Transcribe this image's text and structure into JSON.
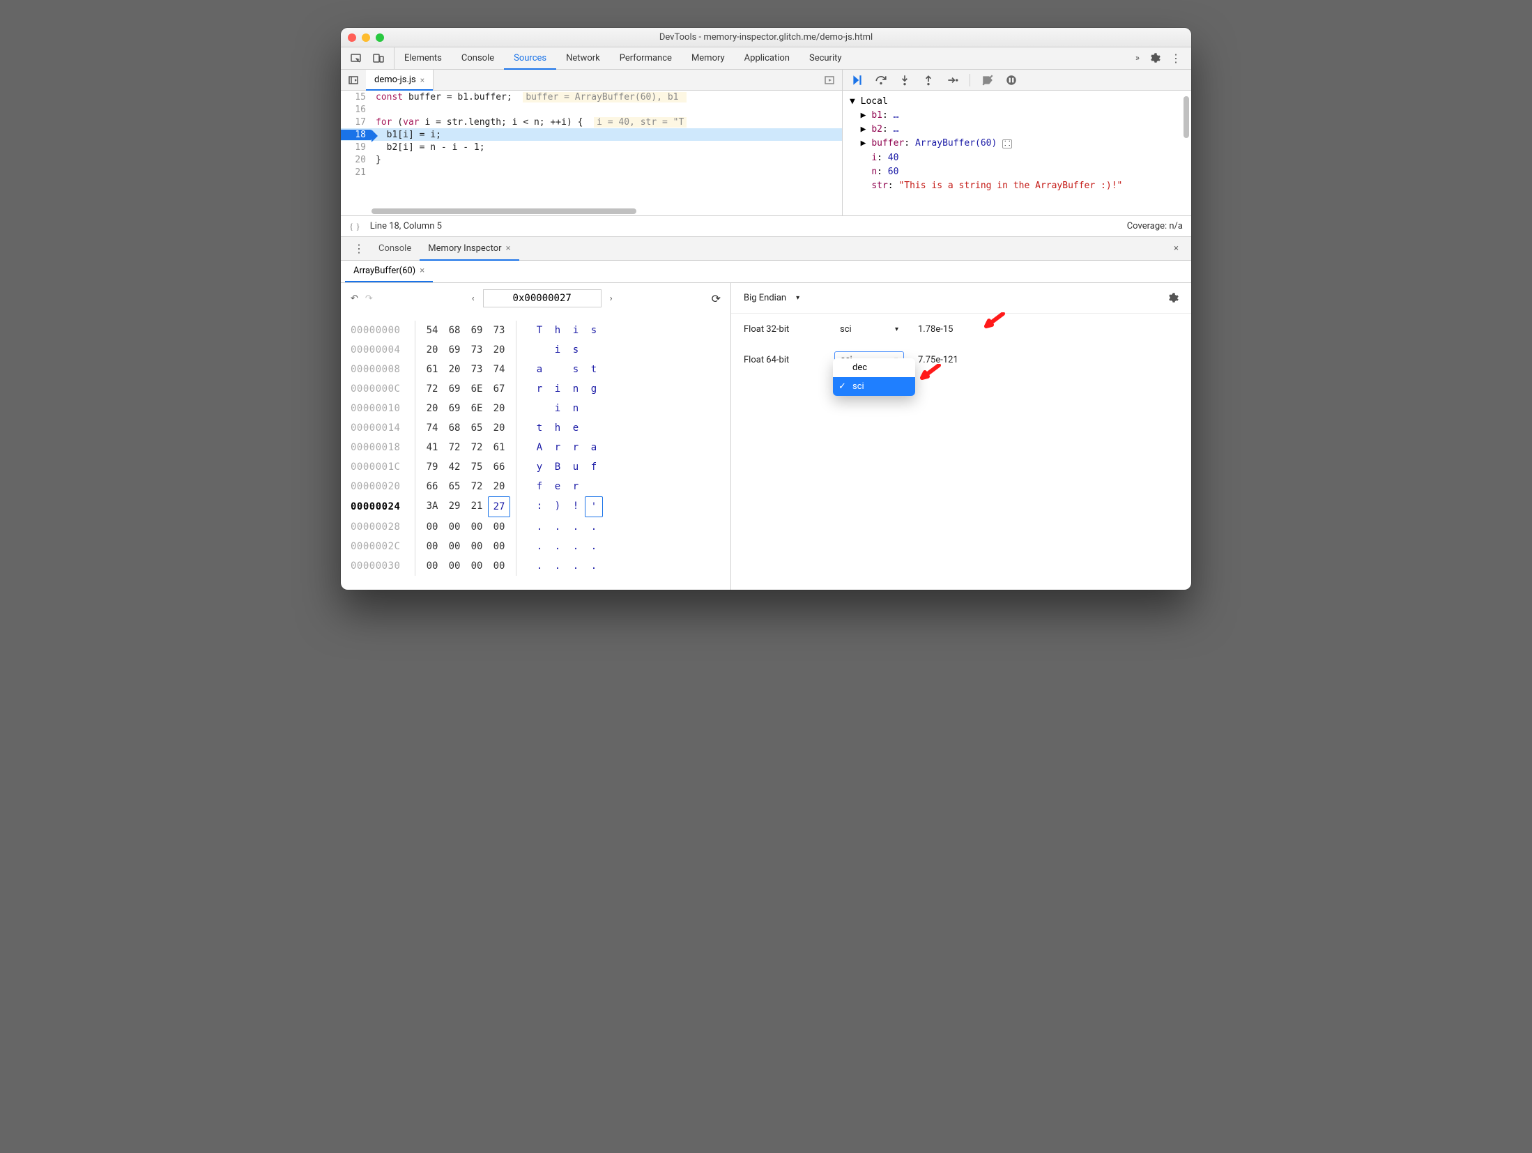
{
  "window": {
    "title": "DevTools - memory-inspector.glitch.me/demo-js.html"
  },
  "main_tabs": {
    "items": [
      "Elements",
      "Console",
      "Sources",
      "Network",
      "Performance",
      "Memory",
      "Application",
      "Security"
    ],
    "active": "Sources"
  },
  "open_file": {
    "name": "demo-js.js"
  },
  "code": {
    "lines": [
      {
        "n": "15",
        "text": "const buffer = b1.buffer;",
        "hint": "buffer = ArrayBuffer(60), b1 "
      },
      {
        "n": "16",
        "text": ""
      },
      {
        "n": "17",
        "text": "for (var i = str.length; i < n; ++i) {",
        "hint": "i = 40, str = \"T"
      },
      {
        "n": "18",
        "text": "  b1[i] = i;",
        "highlight": true
      },
      {
        "n": "19",
        "text": "  b2[i] = n - i - 1;"
      },
      {
        "n": "20",
        "text": "}"
      },
      {
        "n": "21",
        "text": ""
      }
    ],
    "status_left": "Line 18, Column 5",
    "status_right": "Coverage: n/a"
  },
  "scope": {
    "header": "Local",
    "rows": [
      {
        "k": "b1",
        "v": "…",
        "expandable": true
      },
      {
        "k": "b2",
        "v": "…",
        "expandable": true
      },
      {
        "k": "buffer",
        "v": "ArrayBuffer(60)",
        "expandable": true,
        "icon": true
      },
      {
        "k": "i",
        "v": "40"
      },
      {
        "k": "n",
        "v": "60"
      },
      {
        "k": "str",
        "v": "\"This is a string in the ArrayBuffer :)!\"",
        "str": true
      }
    ]
  },
  "drawer": {
    "tabs": [
      "Console",
      "Memory Inspector"
    ],
    "active": "Memory Inspector",
    "buffer_tab": "ArrayBuffer(60)"
  },
  "mi": {
    "address": "0x00000027",
    "endian": "Big Endian",
    "rows": [
      {
        "addr": "00000000",
        "b": [
          "54",
          "68",
          "69",
          "73"
        ],
        "a": [
          "T",
          "h",
          "i",
          "s"
        ]
      },
      {
        "addr": "00000004",
        "b": [
          "20",
          "69",
          "73",
          "20"
        ],
        "a": [
          " ",
          "i",
          "s",
          " "
        ]
      },
      {
        "addr": "00000008",
        "b": [
          "61",
          "20",
          "73",
          "74"
        ],
        "a": [
          "a",
          " ",
          "s",
          "t"
        ]
      },
      {
        "addr": "0000000C",
        "b": [
          "72",
          "69",
          "6E",
          "67"
        ],
        "a": [
          "r",
          "i",
          "n",
          "g"
        ]
      },
      {
        "addr": "00000010",
        "b": [
          "20",
          "69",
          "6E",
          "20"
        ],
        "a": [
          " ",
          "i",
          "n",
          " "
        ]
      },
      {
        "addr": "00000014",
        "b": [
          "74",
          "68",
          "65",
          "20"
        ],
        "a": [
          "t",
          "h",
          "e",
          " "
        ]
      },
      {
        "addr": "00000018",
        "b": [
          "41",
          "72",
          "72",
          "61"
        ],
        "a": [
          "A",
          "r",
          "r",
          "a"
        ]
      },
      {
        "addr": "0000001C",
        "b": [
          "79",
          "42",
          "75",
          "66"
        ],
        "a": [
          "y",
          "B",
          "u",
          "f"
        ]
      },
      {
        "addr": "00000020",
        "b": [
          "66",
          "65",
          "72",
          "20"
        ],
        "a": [
          "f",
          "e",
          "r",
          " "
        ]
      },
      {
        "addr": "00000024",
        "b": [
          "3A",
          "29",
          "21",
          "27"
        ],
        "a": [
          ":",
          ")",
          "!",
          "'"
        ],
        "sel": 3
      },
      {
        "addr": "00000028",
        "b": [
          "00",
          "00",
          "00",
          "00"
        ],
        "a": [
          ".",
          ".",
          ".",
          "."
        ]
      },
      {
        "addr": "0000002C",
        "b": [
          "00",
          "00",
          "00",
          "00"
        ],
        "a": [
          ".",
          ".",
          ".",
          "."
        ]
      },
      {
        "addr": "00000030",
        "b": [
          "00",
          "00",
          "00",
          "00"
        ],
        "a": [
          ".",
          ".",
          ".",
          "."
        ]
      }
    ],
    "values": [
      {
        "label": "Float 32-bit",
        "mode": "sci",
        "value": "1.78e-15",
        "open": false
      },
      {
        "label": "Float 64-bit",
        "mode": "sci",
        "value": "7.75e-121",
        "open": true
      }
    ],
    "mode_options": [
      "dec",
      "sci"
    ],
    "mode_selected": "sci"
  }
}
